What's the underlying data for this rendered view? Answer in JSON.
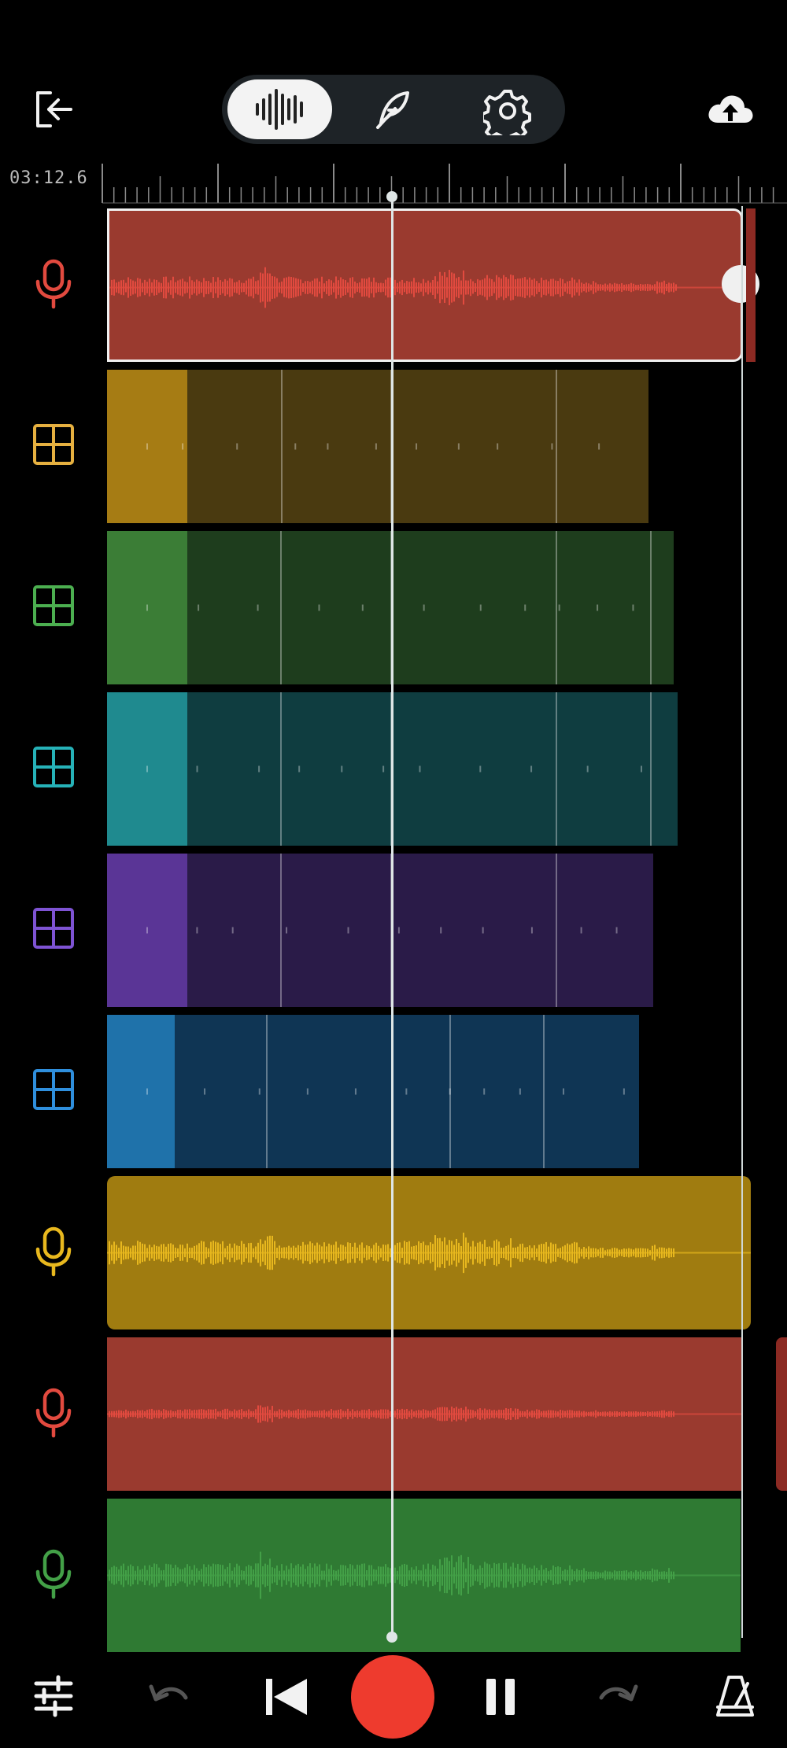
{
  "header": {
    "exit_icon": "exit-icon",
    "modes": [
      {
        "name": "waveform-icon",
        "selected": true
      },
      {
        "name": "quill-icon",
        "selected": false
      },
      {
        "name": "gear-icon",
        "selected": false
      }
    ],
    "upload_icon": "cloud-upload-icon"
  },
  "ruler": {
    "time": "03:12.6"
  },
  "tracks": [
    {
      "kind": "audio",
      "icon": "microphone-icon",
      "color": "#e24a3f",
      "clip_color": "#9a3a2f",
      "selected": true
    },
    {
      "kind": "pattern",
      "icon": "grid-icon",
      "color": "#e6b040",
      "clip_color": "#4a3a10",
      "head_color": "#a67c14"
    },
    {
      "kind": "pattern",
      "icon": "grid-icon",
      "color": "#4caf50",
      "clip_color": "#1e3d1d",
      "head_color": "#3b7d36"
    },
    {
      "kind": "pattern",
      "icon": "grid-icon",
      "color": "#26b2b8",
      "clip_color": "#0f3d40",
      "head_color": "#1f8a8f"
    },
    {
      "kind": "pattern",
      "icon": "grid-icon",
      "color": "#7e53d3",
      "clip_color": "#2a1b48",
      "head_color": "#5a3596"
    },
    {
      "kind": "pattern",
      "icon": "grid-icon",
      "color": "#2f8fdd",
      "clip_color": "#0f3554",
      "head_color": "#1f72aa"
    },
    {
      "kind": "audio",
      "icon": "microphone-icon",
      "color": "#e8b81e",
      "clip_color": "#a07c10"
    },
    {
      "kind": "audio",
      "icon": "microphone-icon",
      "color": "#e24a3f",
      "clip_color": "#9a3a2f"
    },
    {
      "kind": "audio",
      "icon": "microphone-icon",
      "color": "#43a047",
      "clip_color": "#2f7a33"
    }
  ],
  "footer": {
    "buttons": [
      "mixer-sliders-icon",
      "undo-icon",
      "skip-to-start-icon",
      "record-button",
      "pause-icon",
      "redo-icon",
      "metronome-icon"
    ],
    "record_color": "#ee3b2e"
  }
}
